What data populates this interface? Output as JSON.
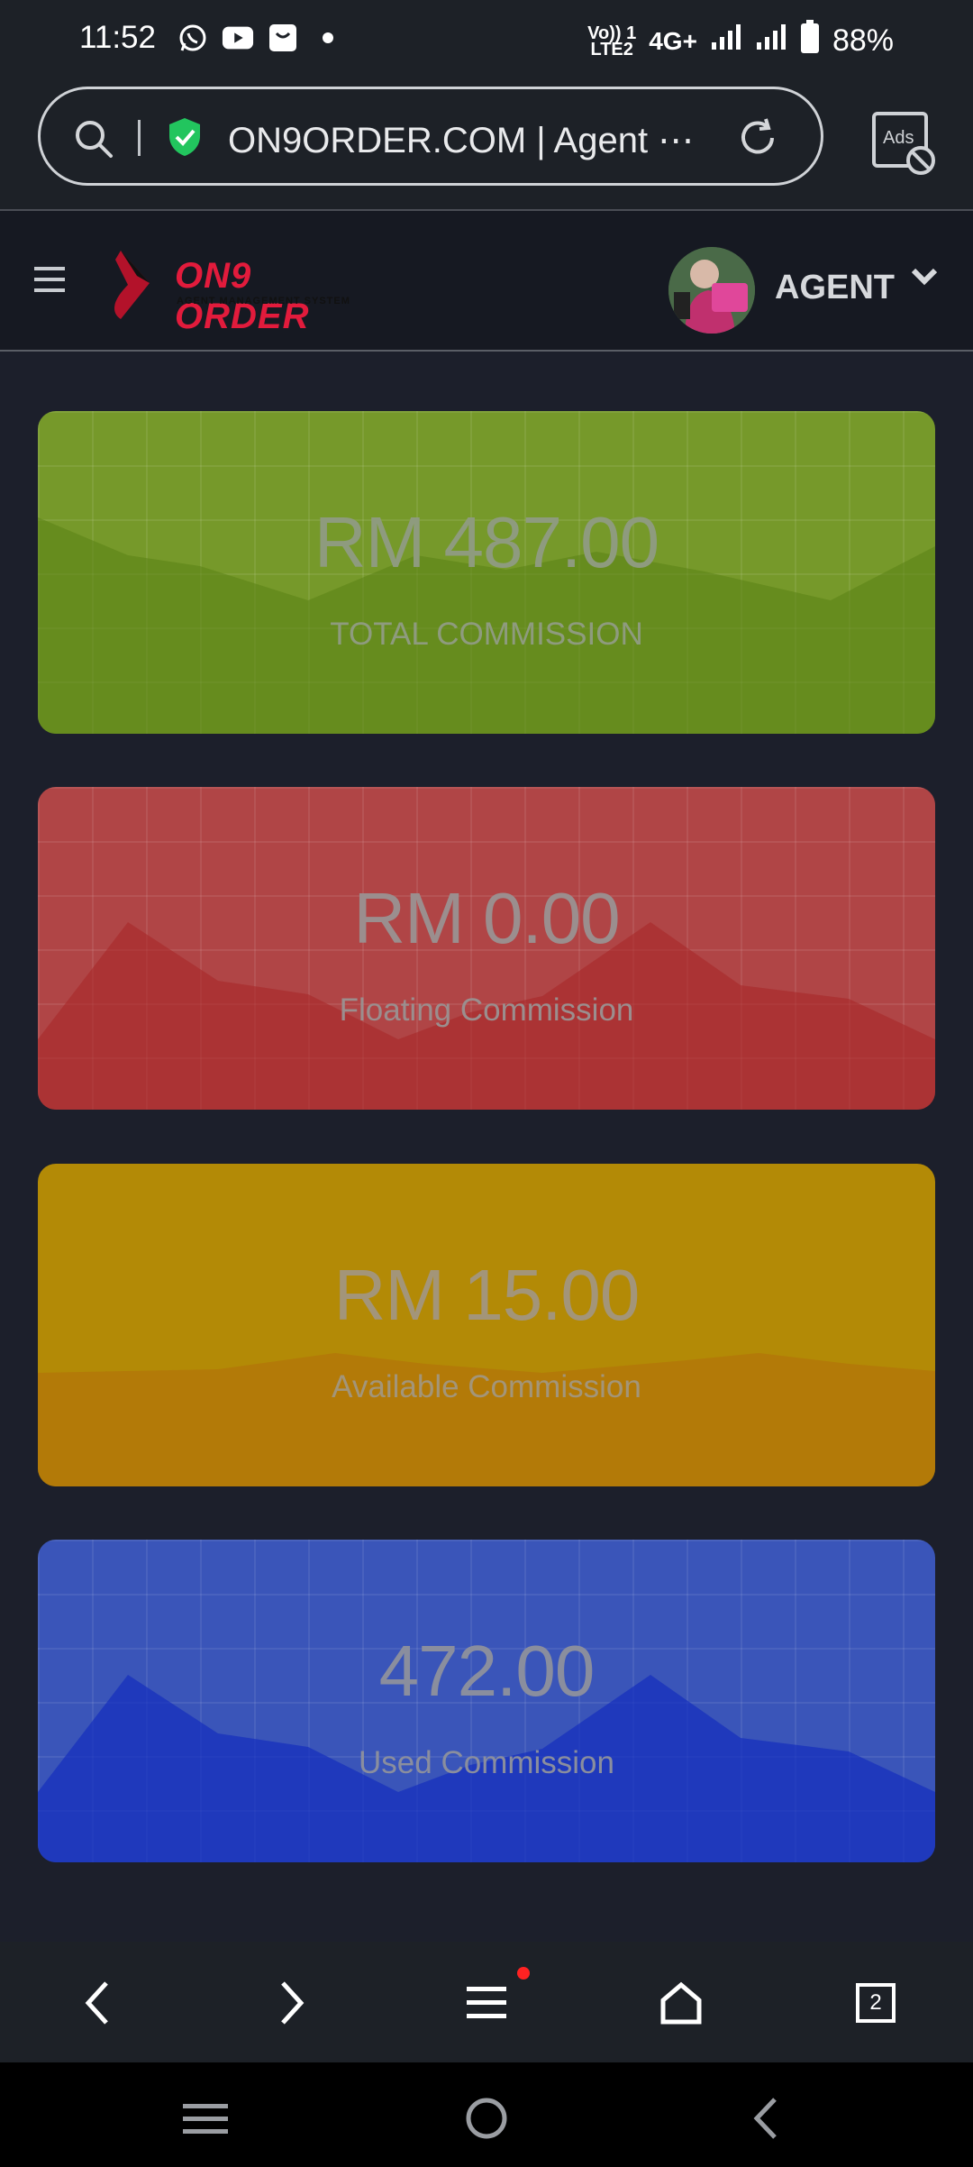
{
  "status_bar": {
    "time": "11:52",
    "network": "4G+",
    "volte": "Vo)) 1",
    "lte": "LTE2",
    "battery": "88%"
  },
  "browser": {
    "url_text": "ON9ORDER.COM | Agent ⋯",
    "ads_label": "Ads"
  },
  "header": {
    "logo_text": "ON9 ORDER",
    "logo_subtitle": "AGENT MANAGEMENT SYSTEM",
    "user_name": "AGENT"
  },
  "cards": [
    {
      "value": "RM 487.00",
      "label": "TOTAL COMMISSION",
      "color": "#76992a"
    },
    {
      "value": "RM 0.00",
      "label": "Floating Commission",
      "color": "#b04546"
    },
    {
      "value": "RM 15.00",
      "label": "Available Commission",
      "color": "#b38a06"
    },
    {
      "value": "472.00",
      "label": "Used Commission",
      "color": "#3a55b9"
    }
  ],
  "browser_nav": {
    "tab_count": "2"
  }
}
